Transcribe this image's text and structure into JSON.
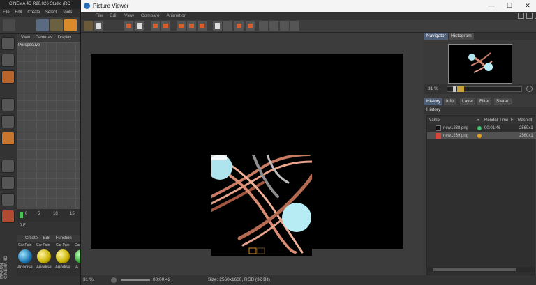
{
  "c4d": {
    "title": "CINEMA 4D R20.026 Studio (RC",
    "menu": [
      "File",
      "Edit",
      "Create",
      "Select",
      "Tools"
    ],
    "viewport_tabs": [
      "View",
      "Cameras",
      "Display"
    ],
    "viewport_label": "Perspective",
    "timeline_ticks": [
      "0",
      "5",
      "10",
      "15"
    ],
    "frame_field": "0 F",
    "material_tabs": [
      "Create",
      "Edit",
      "Function"
    ],
    "material_names": [
      "Car Pain",
      "Car Pain",
      "Car Pain",
      "Car"
    ],
    "material_labels": [
      "Anodise",
      "Anodise",
      "Anodise",
      "A"
    ],
    "brand": "MAXON CINEMA 4D"
  },
  "pv": {
    "title": "Picture Viewer",
    "menu": [
      "File",
      "Edit",
      "View",
      "Compare",
      "Animation"
    ],
    "status": {
      "zoom": "31 %",
      "time": "00:00:42",
      "size": "Size: 2560x1600, RGB (32 Bit)"
    },
    "navigator": {
      "tabs": [
        "Navigator",
        "Histogram"
      ],
      "zoom": "31 %"
    },
    "history": {
      "tabs": [
        "History",
        "Info",
        "Layer",
        "Filter",
        "Stereo"
      ],
      "title": "History",
      "columns": [
        "Name",
        "R",
        "Render Time",
        "F",
        "Resolut"
      ],
      "rows": [
        {
          "name": "new1238.png",
          "time": "00:01:46",
          "res": "2560x1",
          "status_color": "#3ec46d"
        },
        {
          "name": "new1239.png",
          "time": "",
          "res": "2560x1",
          "status_color": "#e0a020"
        }
      ]
    }
  },
  "colors": {
    "accent": "#4f5f78",
    "render_bg": "#000000"
  }
}
